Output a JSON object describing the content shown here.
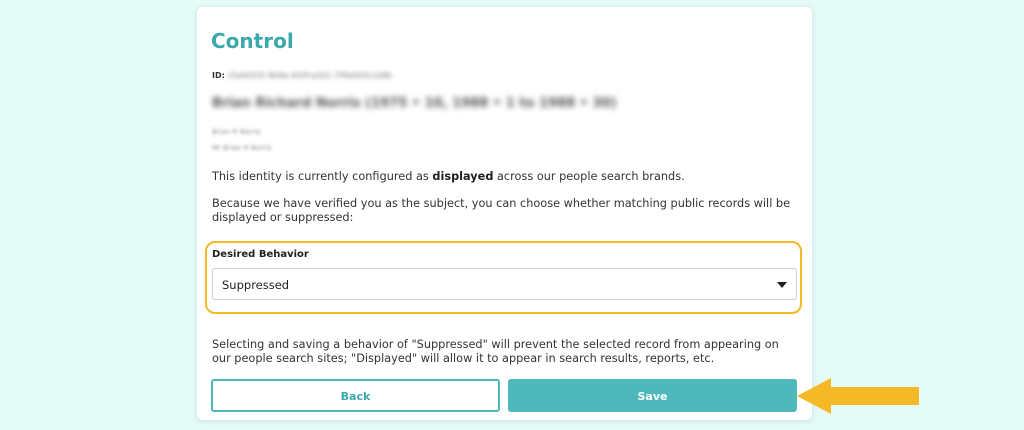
{
  "card": {
    "title": "Control",
    "id_label": "ID:",
    "id_value": "c5a4d1f2-9b6e-4d3f-a2b1-7f9e0d3c2a8b",
    "record_title": "Brian Richard Norris (1975 • 10, 1988 • 1 to 1988 • 30)",
    "aliases": [
      "Brian R Norris",
      "Mr Brian R Norris"
    ],
    "status_text_prefix": "This identity is currently configured as ",
    "status_value": "displayed",
    "status_text_suffix": " across our people search brands.",
    "verified_text": "Because we have verified you as the subject, you can choose whether matching public records will be displayed or suppressed:",
    "behavior_label": "Desired Behavior",
    "behavior_value": "Suppressed",
    "help_text": "Selecting and saving a behavior of \"Suppressed\" will prevent the selected record from appearing on our people search sites; \"Displayed\" will allow it to appear in search results, reports, etc.",
    "back_label": "Back",
    "save_label": "Save"
  },
  "colors": {
    "accent": "#4fb8ba",
    "title": "#3aa8ac",
    "highlight": "#f5b826",
    "background": "#e4fbf8"
  }
}
